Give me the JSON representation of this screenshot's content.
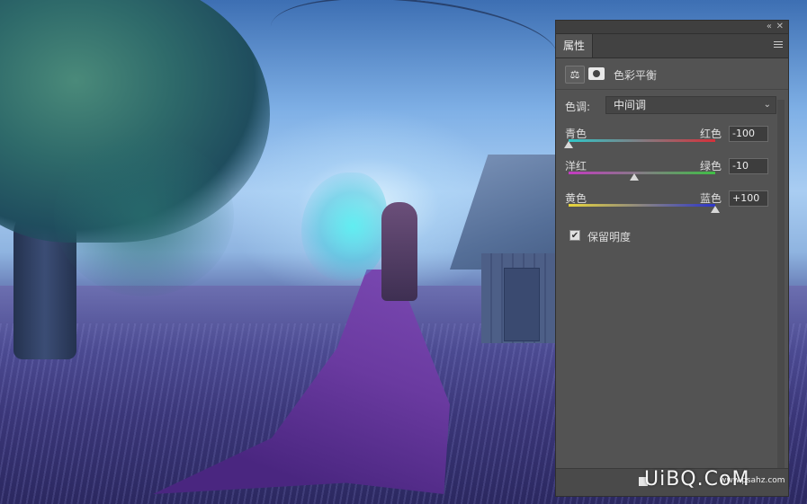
{
  "panel": {
    "collapse_glyph": "«",
    "close_glyph": "✕",
    "tab_label": "属性",
    "title": "色彩平衡",
    "adjustment_icon": "balance-scale-icon",
    "mask_icon": "layer-mask-icon",
    "tone": {
      "label": "色调:",
      "selected": "中间调"
    },
    "sliders": [
      {
        "left": "青色",
        "right": "红色",
        "value": "-100",
        "level": -100,
        "track_from": "#2fc7c9",
        "track_to": "#d6303a"
      },
      {
        "left": "洋红",
        "right": "绿色",
        "value": "-10",
        "level": -10,
        "track_from": "#c43bc1",
        "track_to": "#3fbf45"
      },
      {
        "left": "黄色",
        "right": "蓝色",
        "value": "+100",
        "level": 100,
        "track_from": "#e8d53a",
        "track_to": "#2c35c9"
      }
    ],
    "preserve_luminosity": {
      "label": "保留明度",
      "checked": true,
      "check_glyph": "✔"
    }
  },
  "watermark": {
    "text": "UiBQ.CoM",
    "sub": "www.psahz.com"
  }
}
